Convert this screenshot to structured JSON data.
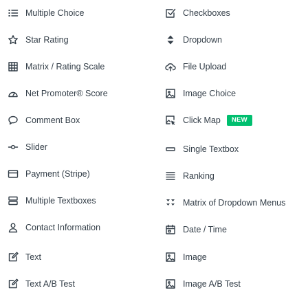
{
  "left_items": [
    {
      "label": "Multiple Choice",
      "icon": "list-icon"
    },
    {
      "label": "Star Rating",
      "icon": "star-icon"
    },
    {
      "label": "Matrix / Rating Scale",
      "icon": "grid-icon"
    },
    {
      "label": "Net Promoter® Score",
      "icon": "gauge-icon"
    },
    {
      "label": "Comment Box",
      "icon": "speech-bubble-icon"
    },
    {
      "label": "Slider",
      "icon": "slider-icon"
    },
    {
      "label": "Payment (Stripe)",
      "icon": "credit-card-icon"
    },
    {
      "label": "Multiple Textboxes",
      "icon": "stacked-textboxes-icon"
    },
    {
      "label": "Contact Information",
      "icon": "person-icon"
    },
    {
      "label": "Text",
      "icon": "edit-icon"
    },
    {
      "label": "Text A/B Test",
      "icon": "edit-icon"
    }
  ],
  "right_items": [
    {
      "label": "Checkboxes",
      "icon": "checkbox-icon"
    },
    {
      "label": "Dropdown",
      "icon": "sort-arrows-icon"
    },
    {
      "label": "File Upload",
      "icon": "cloud-upload-icon"
    },
    {
      "label": "Image Choice",
      "icon": "image-icon"
    },
    {
      "label": "Click Map",
      "icon": "click-map-icon",
      "badge": "NEW"
    },
    {
      "label": "Single Textbox",
      "icon": "textbox-icon"
    },
    {
      "label": "Ranking",
      "icon": "lines-icon"
    },
    {
      "label": "Matrix of Dropdown Menus",
      "icon": "dropdown-matrix-icon"
    },
    {
      "label": "Date / Time",
      "icon": "calendar-icon"
    },
    {
      "label": "Image",
      "icon": "image-icon"
    },
    {
      "label": "Image A/B Test",
      "icon": "image-icon"
    }
  ],
  "colors": {
    "text": "#333e48",
    "icon": "#333e48",
    "badge_bg": "#00bf6f",
    "badge_text": "#ffffff"
  }
}
